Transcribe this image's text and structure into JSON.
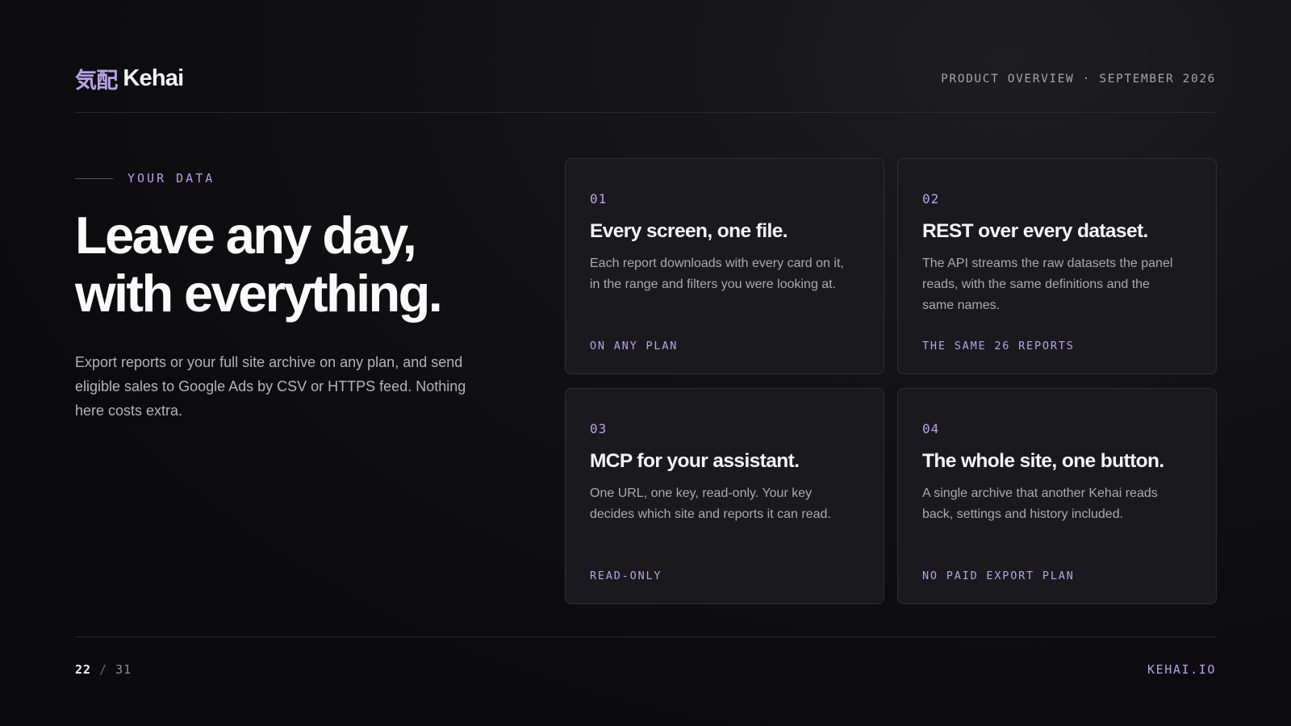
{
  "header": {
    "logo_mark": "気配",
    "logo_name": "Kehai",
    "meta": "PRODUCT OVERVIEW · SEPTEMBER 2026"
  },
  "intro": {
    "eyebrow": "YOUR DATA",
    "headline_line1": "Leave any day,",
    "headline_line2": "with everything.",
    "lede": "Export reports or your full site archive on any plan, and send eligible sales to Google Ads by CSV or HTTPS feed. Nothing here costs extra."
  },
  "cards": [
    {
      "number": "01",
      "title": "Every screen, one file.",
      "body": "Each report downloads with every card on it, in the range and filters you were looking at.",
      "tag": "ON ANY PLAN"
    },
    {
      "number": "02",
      "title": "REST over every dataset.",
      "body": "The API streams the raw datasets the panel reads, with the same definitions and the same names.",
      "tag": "THE SAME 26 REPORTS"
    },
    {
      "number": "03",
      "title": "MCP for your assistant.",
      "body": "One URL, one key, read-only. Your key decides which site and reports it can read.",
      "tag": "READ-ONLY"
    },
    {
      "number": "04",
      "title": "The whole site, one button.",
      "body": "A single archive that another Kehai reads back, settings and history included.",
      "tag": "NO PAID EXPORT PLAN"
    }
  ],
  "footer": {
    "page_current": "22",
    "page_separator": "/",
    "page_total": "31",
    "site": "KEHAI.IO"
  },
  "colors": {
    "background": "#0b0b0d",
    "accent": "#b9a1e8",
    "card_background": "#1a1a1e"
  }
}
